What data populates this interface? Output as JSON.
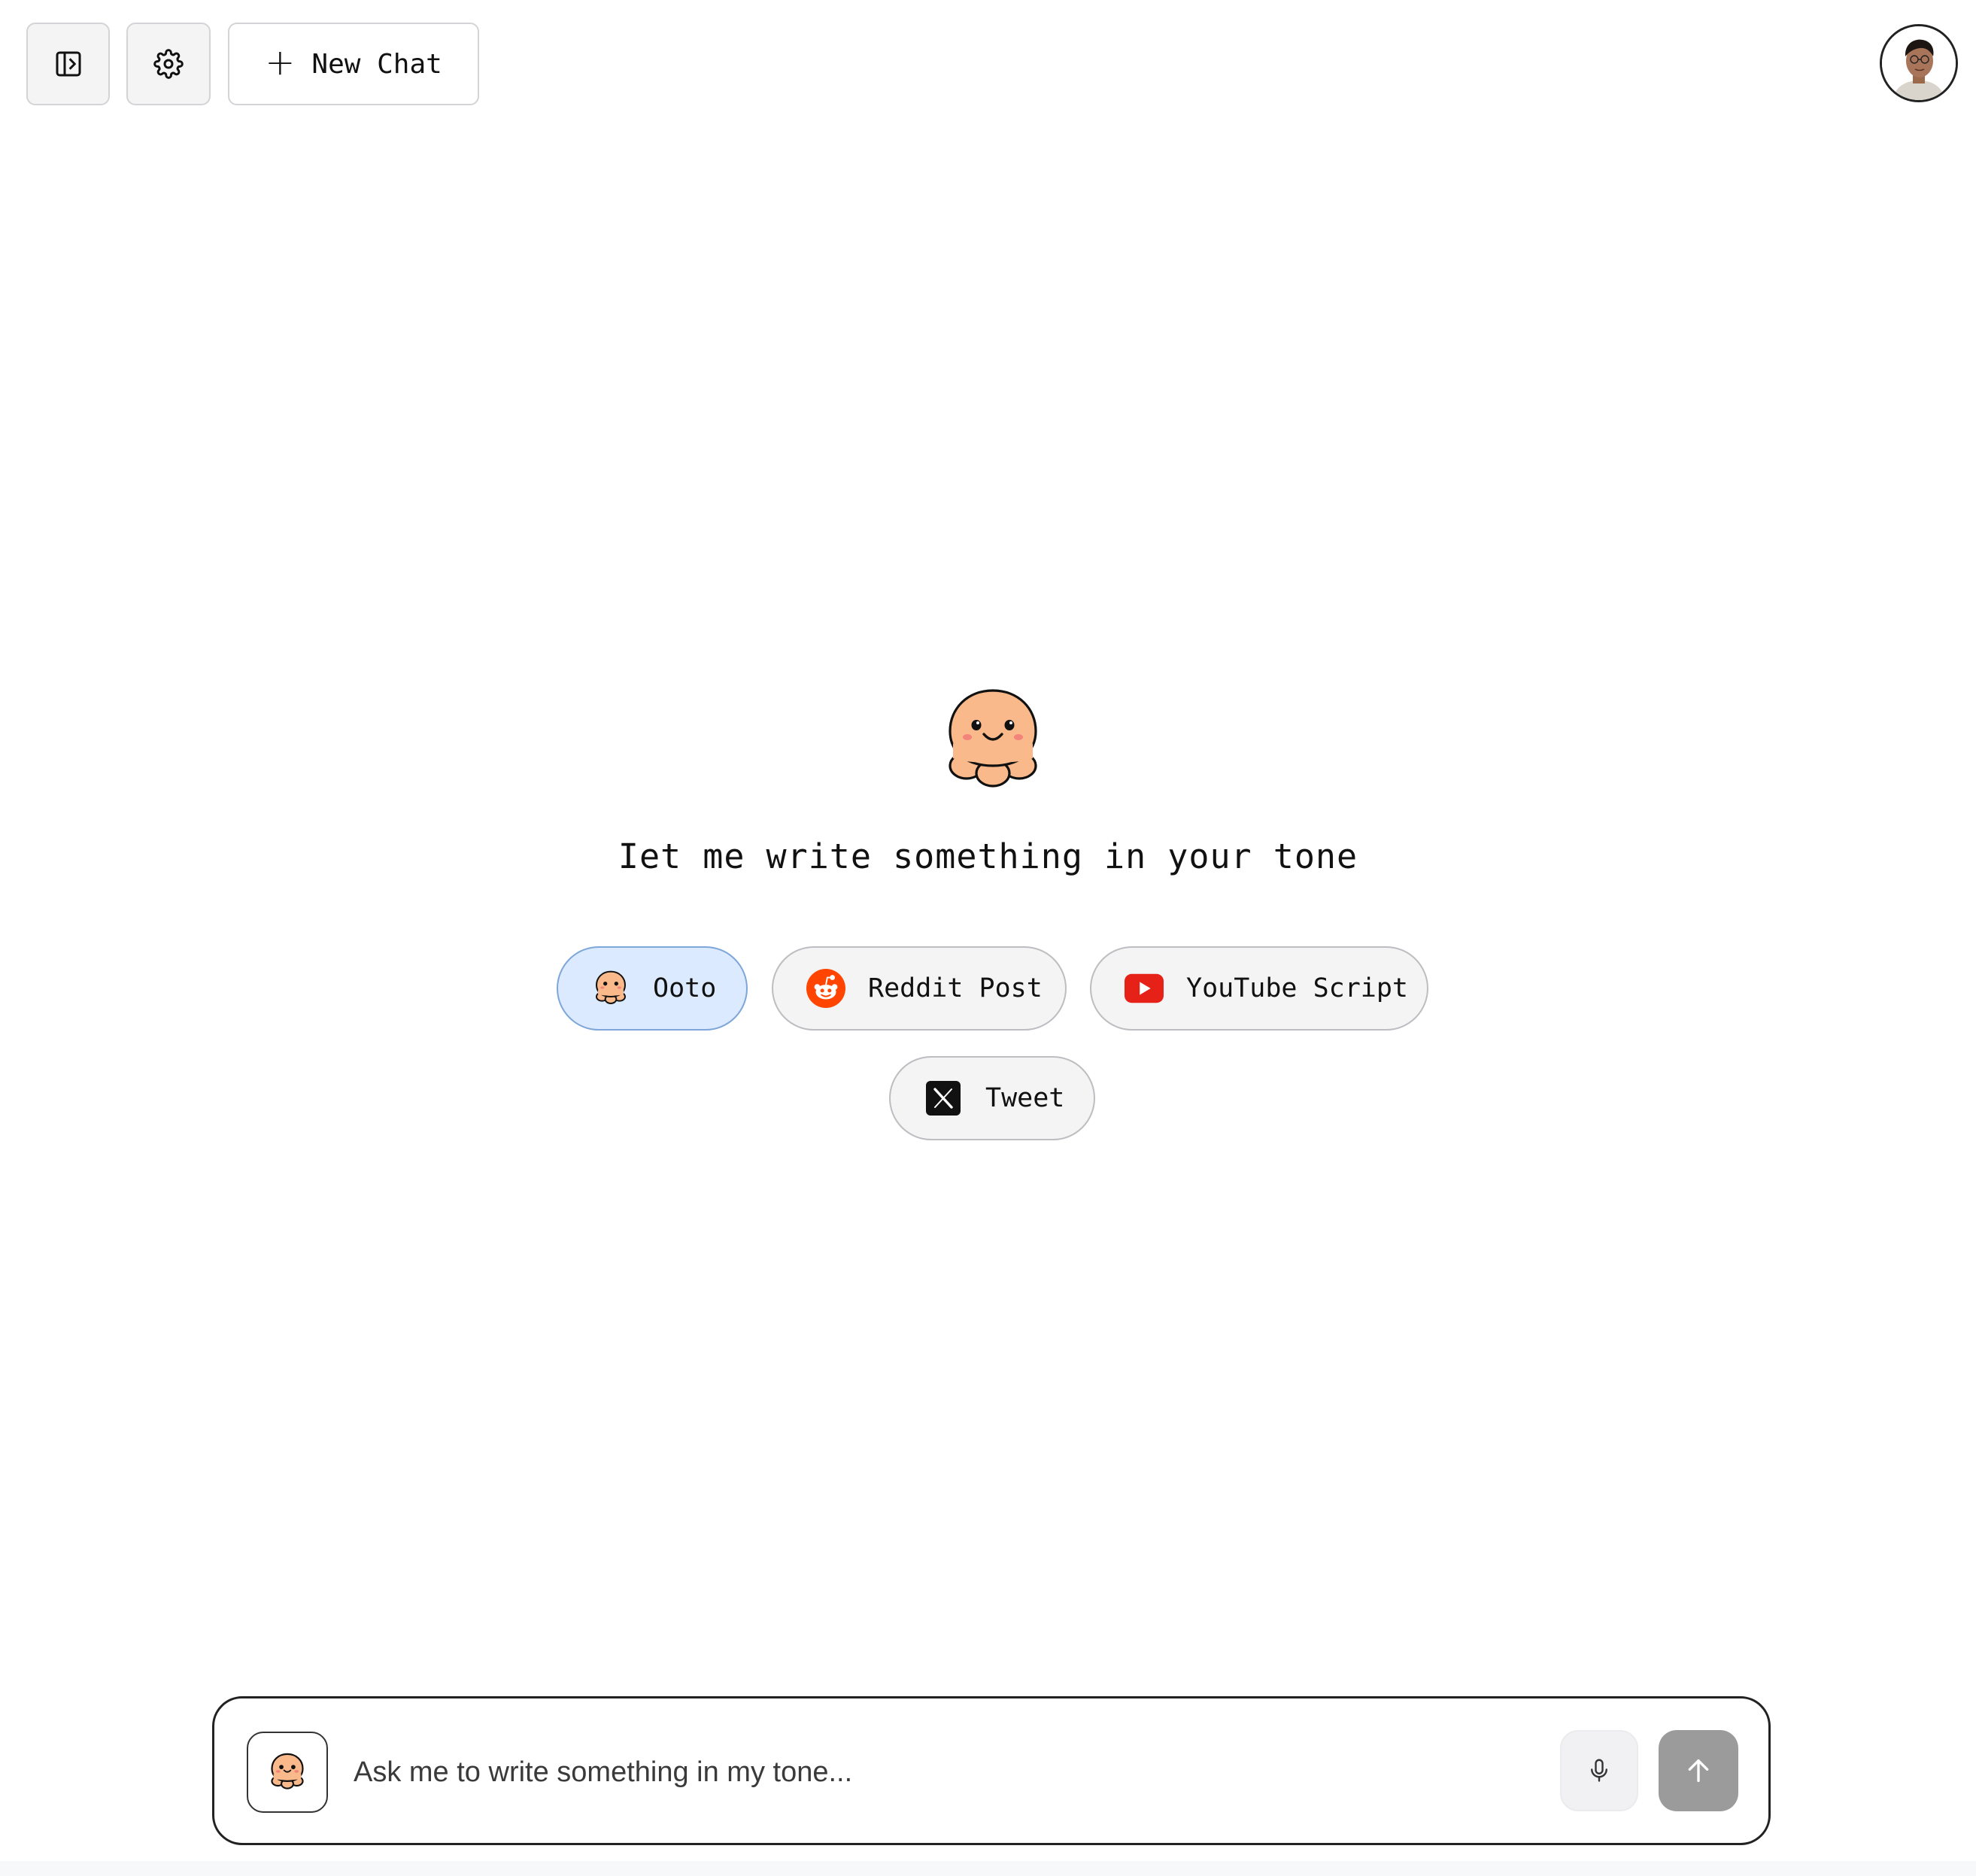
{
  "topbar": {
    "sidebar_icon": "sidebar-toggle-icon",
    "settings_icon": "gear-icon",
    "new_chat_label": "New Chat",
    "new_chat_icon": "plus-icon"
  },
  "user": {
    "avatar_icon": "user-avatar"
  },
  "hero": {
    "mascot_icon": "octopus-mascot-icon",
    "headline": "Iet me write something in your tone"
  },
  "chips": [
    {
      "label": "Ooto",
      "icon": "octopus-icon",
      "active": true
    },
    {
      "label": "Reddit Post",
      "icon": "reddit-icon",
      "active": false
    },
    {
      "label": "YouTube Script",
      "icon": "youtube-icon",
      "active": false
    },
    {
      "label": "Tweet",
      "icon": "x-icon",
      "active": false
    }
  ],
  "composer": {
    "placeholder": "Ask me to write something in my tone...",
    "value": "",
    "mascot_icon": "octopus-icon",
    "mic_icon": "microphone-icon",
    "send_icon": "arrow-up-icon"
  },
  "colors": {
    "mascot": "#f9b98a",
    "mascot_cheek": "#f2847a",
    "active_chip_bg": "#dbeafe",
    "reddit": "#ff4500",
    "youtube": "#e62117",
    "x_bg": "#111111",
    "send_button": "#9b9b9b"
  }
}
